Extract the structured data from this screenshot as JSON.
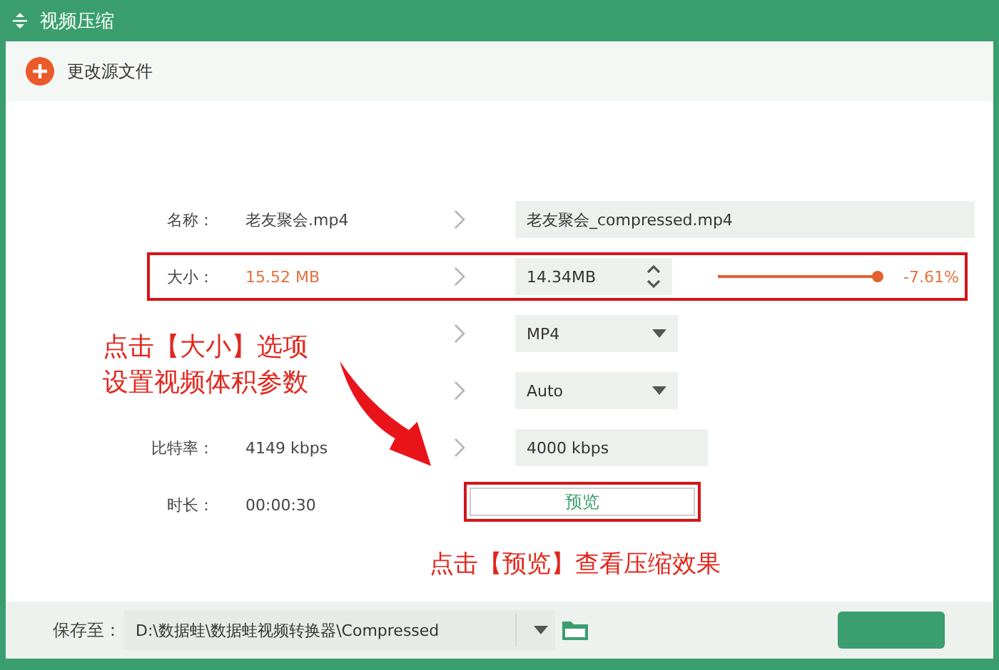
{
  "window": {
    "title": "视频压缩"
  },
  "toolbar": {
    "change_source": "更改源文件"
  },
  "rows": [
    {
      "label": "名称：",
      "value": "老友聚会.mp4",
      "emphasis": false,
      "arrow": true,
      "framed": false,
      "output": {
        "kind": "field",
        "value": "老友聚会_compressed.mp4"
      }
    },
    {
      "label": "大小：",
      "value": "15.52 MB",
      "emphasis": true,
      "arrow": true,
      "framed": true,
      "output": {
        "kind": "spinner",
        "value": "14.34MB",
        "level": 1,
        "reading": "-7.61%"
      }
    },
    {
      "arrow": true,
      "framed": false,
      "output": {
        "kind": "select",
        "value": "MP4"
      }
    },
    {
      "arrow": true,
      "framed": false,
      "output": {
        "kind": "select",
        "value": "Auto"
      }
    },
    {
      "label": "比特率：",
      "value": "4149 kbps",
      "emphasis": false,
      "arrow": true,
      "framed": false,
      "output": {
        "kind": "field",
        "value": "4000 kbps"
      }
    },
    {
      "label": "时长：",
      "value": "00:00:30",
      "emphasis": false,
      "arrow": false,
      "framed": true,
      "output": {
        "kind": "button",
        "value": "预览"
      }
    }
  ],
  "annotations": {
    "note_lines": [
      "点击【大小】选项",
      "设置视频体积参数"
    ],
    "caption": "点击【预览】查看压缩效果"
  },
  "footer": {
    "label": "保存至：",
    "path": "D:\\数据蛙\\数据蛙视频转换器\\Compressed"
  }
}
